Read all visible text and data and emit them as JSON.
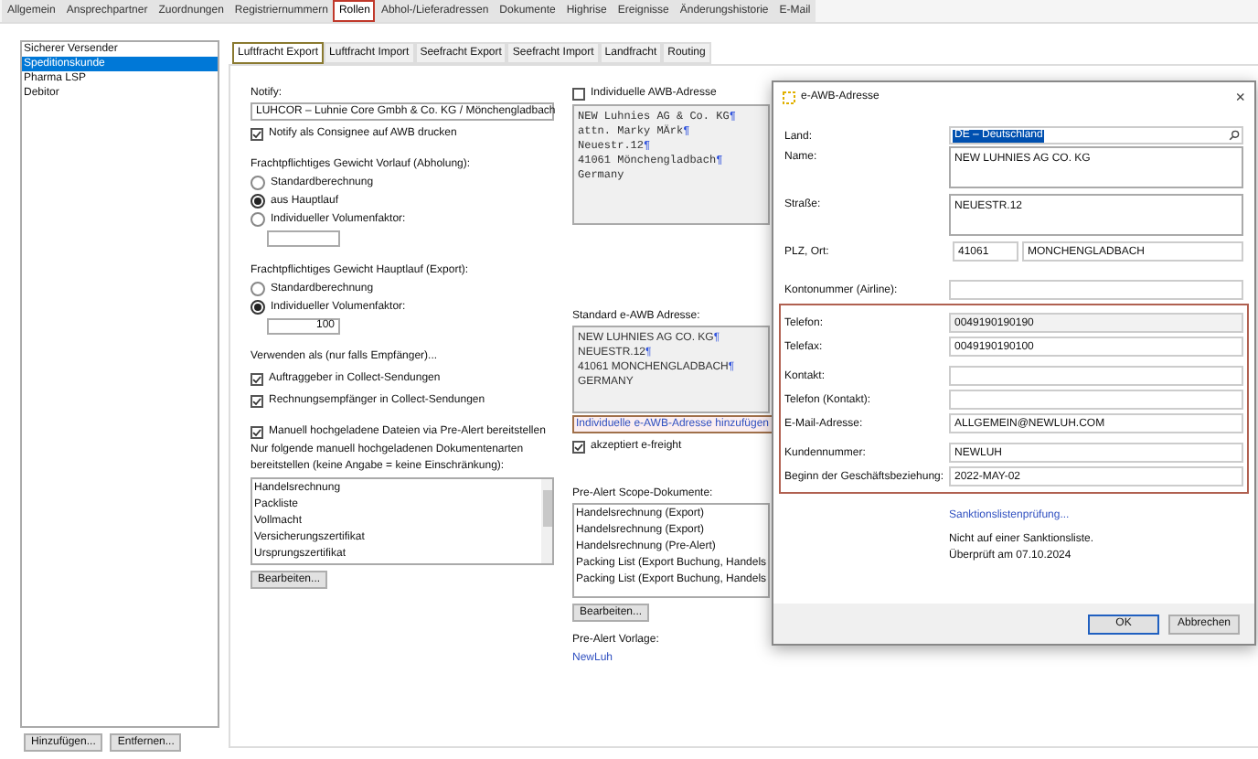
{
  "top_tabs": [
    {
      "label": "Allgemein",
      "selected": false,
      "highlighted": false
    },
    {
      "label": "Ansprechpartner",
      "selected": false,
      "highlighted": false
    },
    {
      "label": "Zuordnungen",
      "selected": false,
      "highlighted": false
    },
    {
      "label": "Registriernummern",
      "selected": false,
      "highlighted": false
    },
    {
      "label": "Rollen",
      "selected": true,
      "highlighted": true
    },
    {
      "label": "Abhol-/Lieferadressen",
      "selected": false,
      "highlighted": false
    },
    {
      "label": "Dokumente",
      "selected": false,
      "highlighted": false
    },
    {
      "label": "Highrise",
      "selected": false,
      "highlighted": false
    },
    {
      "label": "Ereignisse",
      "selected": false,
      "highlighted": false
    },
    {
      "label": "Änderungshistorie",
      "selected": false,
      "highlighted": false
    },
    {
      "label": "E-Mail",
      "selected": false,
      "highlighted": false
    }
  ],
  "roles": {
    "items": [
      {
        "label": "Sicherer Versender",
        "selected": false
      },
      {
        "label": "Speditionskunde",
        "selected": true
      },
      {
        "label": "Pharma LSP",
        "selected": false
      },
      {
        "label": "Debitor",
        "selected": false
      }
    ],
    "buttons": [
      "Hinzufügen...",
      "Entfernen..."
    ]
  },
  "sub_tabs": [
    {
      "label": "Luftfracht Export",
      "selected": true,
      "highlighted": true
    },
    {
      "label": "Luftfracht Import",
      "selected": false,
      "highlighted": false
    },
    {
      "label": "Seefracht Export",
      "selected": false,
      "highlighted": false
    },
    {
      "label": "Seefracht Import",
      "selected": false,
      "highlighted": false
    },
    {
      "label": "Landfracht",
      "selected": false,
      "highlighted": false
    },
    {
      "label": "Routing",
      "selected": false,
      "highlighted": false
    }
  ],
  "notify": {
    "label": "Notify:",
    "value": "LUHCOR – Luhnie Core Gmbh & Co. KG / Mönchengladbach",
    "checkbox": {
      "label": "Notify als Consignee auf AWB drucken",
      "checked": true
    }
  },
  "vorlauf": {
    "label": "Frachtpflichtiges Gewicht Vorlauf (Abholung):",
    "options": [
      {
        "label": "Standardberechnung",
        "selected": false
      },
      {
        "label": "aus Hauptlauf",
        "selected": true
      },
      {
        "label": "Individueller Volumenfaktor:",
        "selected": false
      }
    ]
  },
  "hauptlauf": {
    "label": "Frachtpflichtiges Gewicht Hauptlauf (Export):",
    "options": [
      {
        "label": "Standardberechnung",
        "selected": false
      },
      {
        "label": "Individueller Volumenfaktor:",
        "selected": true
      }
    ],
    "factor": "100"
  },
  "verwenden": {
    "label": "Verwenden als (nur falls Empfänger)...",
    "checkboxes": [
      {
        "label": "Auftraggeber in Collect-Sendungen",
        "checked": true
      },
      {
        "label": "Rechnungsempfänger in Collect-Sendungen",
        "checked": true
      }
    ]
  },
  "pre_alert_files": {
    "checkbox": {
      "label": "Manuell hochgeladene Dateien via Pre-Alert bereitstellen",
      "checked": true
    },
    "note": "Nur folgende manuell hochgeladenen Dokumentenarten bereitstellen (keine Angabe = keine Einschränkung):",
    "items": [
      "Handelsrechnung",
      "Packliste",
      "Vollmacht",
      "Versicherungszertifikat",
      "Ursprungszertifikat"
    ],
    "button": "Bearbeiten..."
  },
  "awb": {
    "checkbox": {
      "label": "Individuelle AWB-Adresse",
      "checked": false
    },
    "lines": [
      {
        "text": "NEW Luhnies AG & Co. KG",
        "mark": "¶"
      },
      {
        "text": "attn. Marky MÄrk",
        "mark": "¶"
      },
      {
        "text": "Neuestr.12",
        "mark": "¶"
      },
      {
        "text": "41061 Mönchengladbach",
        "mark": "¶"
      },
      {
        "text": "Germany"
      }
    ],
    "standard_label": "Standard e-AWB Adresse:",
    "standard_lines": [
      {
        "text": "NEW LUHNIES AG  CO. KG",
        "mark": "¶"
      },
      {
        "text": "NEUESTR.12",
        "mark": "¶"
      },
      {
        "text": "41061 MONCHENGLADBACH",
        "mark": "¶"
      },
      {
        "text": "GERMANY"
      }
    ],
    "link": {
      "label": "Individuelle e-AWB-Adresse hinzufügen",
      "highlighted": true
    },
    "efreight": {
      "label": "akzeptiert e-freight",
      "checked": true
    }
  },
  "scope": {
    "label": "Pre-Alert Scope-Dokumente:",
    "items": [
      "Handelsrechnung (Export)",
      "Handelsrechnung (Export)",
      "Handelsrechnung (Pre-Alert)",
      "Packing List (Export Buchung, Handels",
      "Packing List (Export Buchung, Handels"
    ],
    "button": "Bearbeiten..."
  },
  "vorlage": {
    "label": "Pre-Alert Vorlage:",
    "link": "NewLuh"
  },
  "dialog": {
    "title": "e-AWB-Adresse",
    "close": "×",
    "address_fields": [
      {
        "kind": "search",
        "label": "Land:",
        "value": "DE – Deutschland"
      },
      {
        "kind": "tall",
        "label": "Name:",
        "value": "NEW LUHNIES AG   CO. KG"
      },
      {
        "kind": "tall",
        "label": "Straße:",
        "value": "NEUESTR.12"
      },
      {
        "kind": "split",
        "label": "PLZ, Ort:",
        "value": "41061",
        "value_2": "MONCHENGLADBACH"
      },
      {
        "kind": "text",
        "label": "Kontonummer (Airline):"
      }
    ],
    "contact_section": {
      "highlighted": true,
      "fields": [
        {
          "kind": "readonly",
          "label": "Telefon:",
          "value": "0049190190190"
        },
        {
          "kind": "text",
          "label": "Telefax:",
          "value": "0049190190100"
        },
        {
          "kind": "gap"
        },
        {
          "kind": "text",
          "label": "Kontakt:"
        },
        {
          "kind": "text",
          "label": "Telefon (Kontakt):"
        },
        {
          "kind": "text",
          "label": "E-Mail-Adresse:",
          "value": "ALLGEMEIN@NEWLUH.COM"
        },
        {
          "kind": "gap"
        },
        {
          "kind": "text",
          "label": "Kundennummer:",
          "value": "NEWLUH"
        },
        {
          "kind": "text",
          "label": "Beginn der Geschäftsbeziehung:",
          "value": "2022-MAY-02"
        }
      ]
    },
    "sanction_link": "Sanktionslistenprüfung...",
    "sanction_status": [
      "Nicht auf einer Sanktionsliste.",
      "Überprüft am 07.10.2024"
    ],
    "buttons": [
      {
        "label": "OK",
        "default": true
      },
      {
        "label": "Abbrechen",
        "default": false
      }
    ]
  }
}
